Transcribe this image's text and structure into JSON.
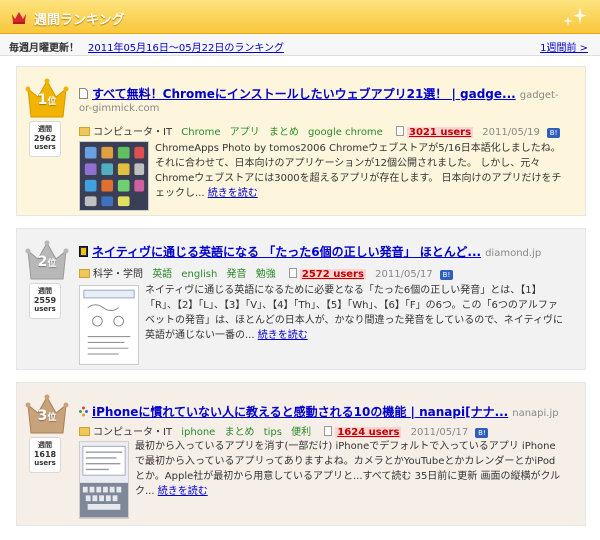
{
  "header": {
    "title": "週間ランキング"
  },
  "subbar": {
    "note": "毎週月曜更新！",
    "date_range": "2011年05月16日～05月22日のランキング",
    "prev_link": "1週間前 >"
  },
  "entries": [
    {
      "rank": "1",
      "rank_suffix": "位",
      "users_label": "週間",
      "users_count": "2962",
      "users_unit": "users",
      "title": "すべて無料！Chromeにインストールしたいウェブアプリ21選！ | gadge...",
      "domain_inline": "gadget-",
      "domain_next": "or-gimmick.com",
      "category": "コンピュータ・IT",
      "tags": [
        "Chrome",
        "アプリ",
        "まとめ",
        "google chrome"
      ],
      "bookmark_count": "3021 users",
      "date": "2011/05/19",
      "description": "ChromeApps Photo by tomos2006 Chromeウェブストアが5/16日本語化しましたね。 それに合わせて、日本向けのアプリケーションが12個公開されました。 しかし、元々Chromeウェブストアには3000を超えるアプリが存在します。 日本向けのアプリだけをチェックし...",
      "read_more": "続きを読む"
    },
    {
      "rank": "2",
      "rank_suffix": "位",
      "users_label": "週間",
      "users_count": "2559",
      "users_unit": "users",
      "title": "ネイティヴに通じる英語になる 「たった6個の正しい発音」 ほとんど...",
      "domain_inline": "diamond.jp",
      "category": "科学・学問",
      "tags": [
        "英語",
        "english",
        "発音",
        "勉強"
      ],
      "bookmark_count": "2572 users",
      "date": "2011/05/17",
      "description": "ネイティヴに通じる英語になるために必要となる「たった6個の正しい発音」とは、【1】「R」、【2】「L」、【3】「V」、【4】「Th」、【5】「Wh」、【6】「F」の6つ。この「6つのアルファベットの発音」は、ほとんどの日本人が、かなり間違った発音をしているので、ネイティヴに英語が通じない一番の...",
      "read_more": "続きを読む"
    },
    {
      "rank": "3",
      "rank_suffix": "位",
      "users_label": "週間",
      "users_count": "1618",
      "users_unit": "users",
      "title": "iPhoneに慣れていない人に教えると感動される10の機能 | nanapi[ナナ...",
      "domain_inline": "nanapi.jp",
      "category": "コンピュータ・IT",
      "tags": [
        "iphone",
        "まとめ",
        "tips",
        "便利"
      ],
      "bookmark_count": "1624 users",
      "date": "2011/05/17",
      "description": "最初から入っているアプリを消す(一部だけ) iPhoneでデフォルトで入っているアプリ iPhoneで最初から入っているアプリってありますよね。カメラとかYouTubeとかカレンダーとかiPodとか。Apple社が最初から用意しているアプリと...すべて読む 35日前に更新 画面の縦横がクルク...",
      "read_more": "続きを読む"
    }
  ],
  "colors": {
    "gold": "#f2b400",
    "silver": "#b8b8b8",
    "bronze": "#c8a27a",
    "link": "#0000cc",
    "tag": "#2a8a2a",
    "count_red": "#c00000"
  }
}
